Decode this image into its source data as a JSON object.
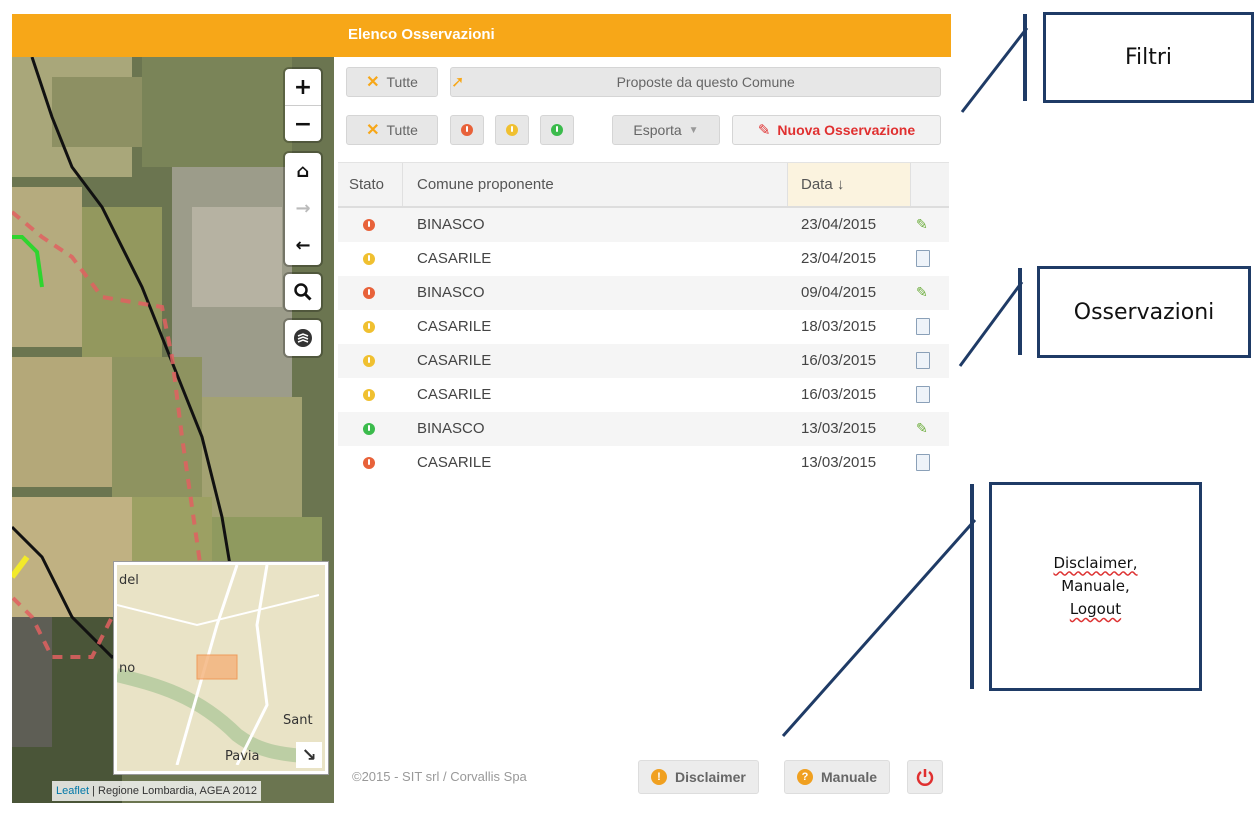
{
  "title": "Elenco Osservazioni",
  "map": {
    "zoom_in": "+",
    "zoom_out": "−",
    "attribution_link": "Leaflet",
    "attribution_text": "| Regione Lombardia, AGEA 2012",
    "minimap_labels": [
      "del",
      "no",
      "Sant",
      "Pavia"
    ],
    "icons": [
      "home-icon",
      "arrow-right-icon",
      "arrow-left-icon",
      "search-icon",
      "layers-icon",
      "expand-icon"
    ]
  },
  "filters": {
    "row1": {
      "all_label": "Tutte",
      "proposed_label": "Proposte da questo Comune"
    },
    "row2": {
      "all_label": "Tutte",
      "export_label": "Esporta",
      "new_label": "Nuova Osservazione"
    }
  },
  "table": {
    "headers": {
      "stato": "Stato",
      "comune": "Comune proponente",
      "data": "Data ↓"
    },
    "rows": [
      {
        "status": "red",
        "comune": "BINASCO",
        "data": "23/04/2015",
        "icon": "pencil"
      },
      {
        "status": "yellow",
        "comune": "CASARILE",
        "data": "23/04/2015",
        "icon": "document"
      },
      {
        "status": "red",
        "comune": "BINASCO",
        "data": "09/04/2015",
        "icon": "pencil"
      },
      {
        "status": "yellow",
        "comune": "CASARILE",
        "data": "18/03/2015",
        "icon": "document"
      },
      {
        "status": "yellow",
        "comune": "CASARILE",
        "data": "16/03/2015",
        "icon": "document"
      },
      {
        "status": "yellow",
        "comune": "CASARILE",
        "data": "16/03/2015",
        "icon": "document"
      },
      {
        "status": "green",
        "comune": "BINASCO",
        "data": "13/03/2015",
        "icon": "pencil"
      },
      {
        "status": "red",
        "comune": "CASARILE",
        "data": "13/03/2015",
        "icon": "document"
      }
    ]
  },
  "footer": {
    "copyright": "©2015 - SIT srl / Corvallis Spa",
    "disclaimer_label": "Disclaimer",
    "manual_label": "Manuale"
  },
  "annotations": {
    "filtri": "Filtri",
    "osservazioni": "Osservazioni",
    "footer_lines": [
      "Disclaimer,",
      "Manuale,",
      "Logout"
    ]
  },
  "colors": {
    "header": "#f7a718",
    "red": "#e8623a",
    "yellow": "#f0c030",
    "green": "#3bbb4c",
    "annotation": "#1f3b66"
  }
}
